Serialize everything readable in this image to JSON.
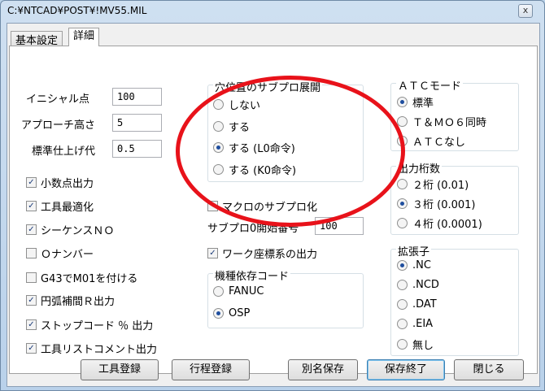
{
  "window": {
    "title": "C:¥NTCAD¥POST¥!MV55.MIL",
    "close": "x"
  },
  "tabs": [
    {
      "label": "基本設定"
    },
    {
      "label": "詳細"
    }
  ],
  "fields": [
    {
      "label": "イニシャル点",
      "value": "100"
    },
    {
      "label": "アプローチ高さ",
      "value": "5"
    },
    {
      "label": "標準仕上げ代",
      "value": "0.5"
    }
  ],
  "left_checks": [
    {
      "label": "小数点出力",
      "checked": true
    },
    {
      "label": "工具最適化",
      "checked": true
    },
    {
      "label": "シーケンスＮＯ",
      "checked": true
    },
    {
      "label": "Ｏナンバー",
      "checked": false
    },
    {
      "label": "G43でM01を付ける",
      "checked": false
    },
    {
      "label": "円弧補間Ｒ出力",
      "checked": true
    },
    {
      "label": "ストップコード ％ 出力",
      "checked": true
    },
    {
      "label": "工具リストコメント出力",
      "checked": true
    }
  ],
  "subprog": {
    "legend": "穴位置のサブプロ展開",
    "options": [
      {
        "label": "しない",
        "selected": false
      },
      {
        "label": "する",
        "selected": false
      },
      {
        "label": "する (L0命令)",
        "selected": true
      },
      {
        "label": "する (K0命令)",
        "selected": false
      }
    ]
  },
  "macro_check": {
    "label": "マクロのサブプロ化",
    "checked": false
  },
  "subprog_start": {
    "label": "サブプロ0開始番号",
    "value": "100"
  },
  "work_check": {
    "label": "ワーク座標系の出力",
    "checked": true
  },
  "machine": {
    "legend": "機種依存コード",
    "options": [
      {
        "label": "FANUC",
        "selected": false
      },
      {
        "label": "OSP",
        "selected": true
      }
    ]
  },
  "atc": {
    "legend": "ＡＴＣモード",
    "options": [
      {
        "label": "標準",
        "selected": true
      },
      {
        "label": "Ｔ＆ＭＯ６同時",
        "selected": false
      },
      {
        "label": "ＡＴＣなし",
        "selected": false
      }
    ]
  },
  "digits": {
    "legend": "出力桁数",
    "options": [
      {
        "label": "２桁 (0.01)",
        "selected": false
      },
      {
        "label": "３桁 (0.001)",
        "selected": true
      },
      {
        "label": "４桁 (0.0001)",
        "selected": false
      }
    ]
  },
  "ext": {
    "legend": "拡張子",
    "options": [
      {
        "label": ".NC",
        "selected": true
      },
      {
        "label": ".NCD",
        "selected": false
      },
      {
        "label": ".DAT",
        "selected": false
      },
      {
        "label": ".EIA",
        "selected": false
      },
      {
        "label": "無し",
        "selected": false
      }
    ]
  },
  "buttons": {
    "tool_register": "工具登録",
    "process_register": "行程登録",
    "save_as": "別名保存",
    "save_exit": "保存終了",
    "close": "閉じる"
  },
  "colors": {
    "annotation": "#e8121a",
    "selected_dot": "#1f4e9e"
  }
}
